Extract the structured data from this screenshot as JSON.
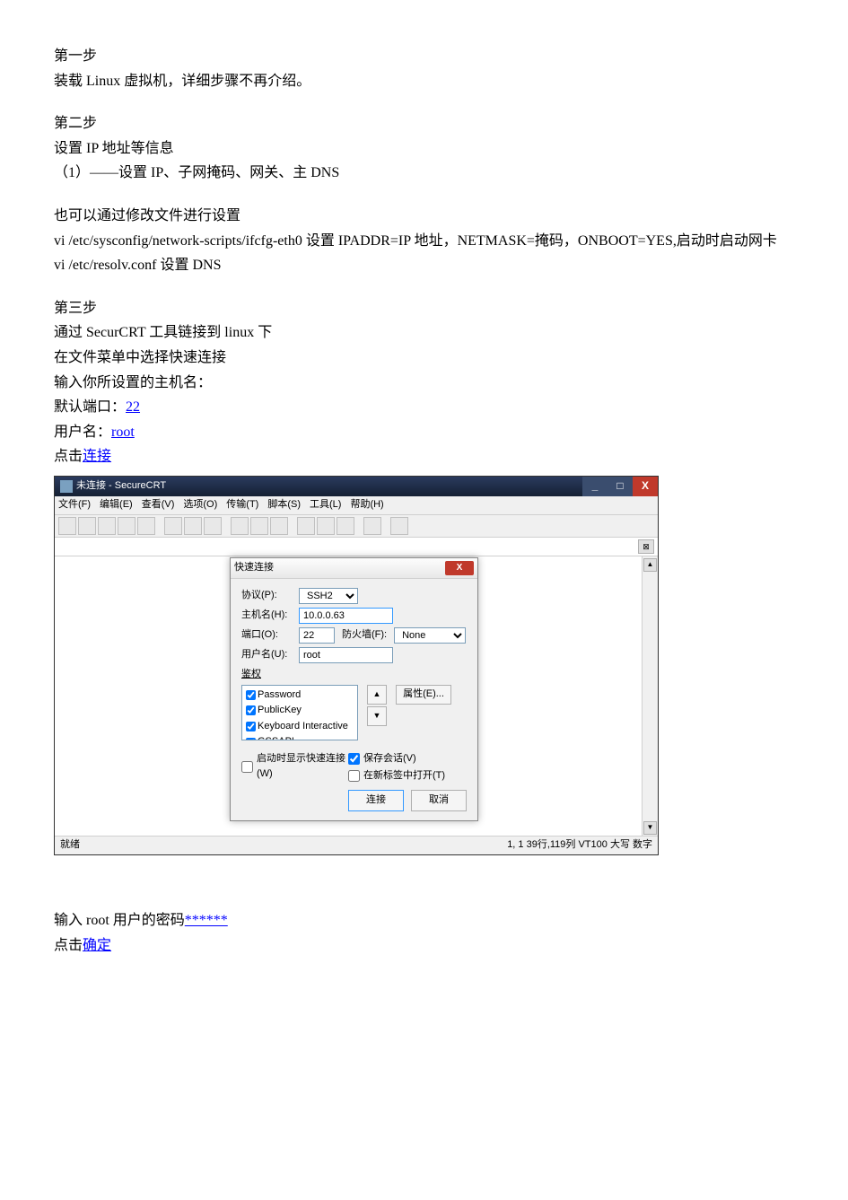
{
  "step1": {
    "title": "第一步",
    "line1": "装载 Linux 虚拟机，详细步骤不再介绍。"
  },
  "step2": {
    "title": "第二步",
    "line1": "设置 IP 地址等信息",
    "line2": "（1）——设置 IP、子网掩码、网关、主 DNS",
    "line3": "也可以通过修改文件进行设置",
    "line4a": "vi /etc/sysconfig/network-scripts/ifcfg-eth0   设置 IPADDR=IP 地址，NETMASK=掩码，ONBOOT=YES,启动时启动网卡",
    "line5": "vi /etc/resolv.conf      设置 DNS"
  },
  "step3": {
    "title": "第三步",
    "line1": "通过 SecurCRT 工具链接到 linux 下",
    "line2": "在文件菜单中选择快速连接",
    "line3": "输入你所设置的主机名：",
    "port_label": "默认端口：",
    "port_link": "22",
    "user_label": "用户名：",
    "user_link": "root",
    "click_label": "点击",
    "connect_link": "连接"
  },
  "screenshot": {
    "title": "未连接 - SecureCRT",
    "menu": [
      "文件(F)",
      "编辑(E)",
      "查看(V)",
      "选项(O)",
      "传输(T)",
      "脚本(S)",
      "工具(L)",
      "帮助(H)"
    ],
    "status_left": "就绪",
    "status_right": "1,   1   39行,119列  VT100      大写  数字",
    "dialog": {
      "title": "快速连接",
      "protocol_label": "协议(P):",
      "protocol_value": "SSH2",
      "host_label": "主机名(H):",
      "host_value": "10.0.0.63",
      "port_label": "端口(O):",
      "port_value": "22",
      "firewall_label": "防火墙(F):",
      "firewall_value": "None",
      "user_label": "用户名(U):",
      "user_value": "root",
      "auth_label": "鉴权",
      "auth_items": [
        "Password",
        "PublicKey",
        "Keyboard Interactive",
        "GSSAPI"
      ],
      "props_btn": "属性(E)...",
      "show_on_start": "启动时显示快速连接(W)",
      "save_session": "保存会话(V)",
      "open_in_tab": "在新标签中打开(T)",
      "connect_btn": "连接",
      "cancel_btn": "取消"
    }
  },
  "after": {
    "line1a": "输入 root 用户的密码",
    "line1b": "******",
    "line2a": "点击",
    "line2b": "确定"
  }
}
